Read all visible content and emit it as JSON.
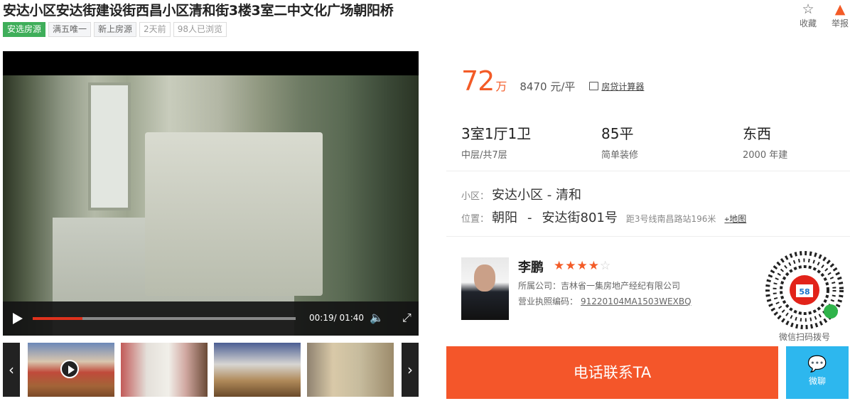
{
  "title": "安达小区安达街建设街西昌小区清和街3楼3室二中文化广场朝阳桥",
  "tags": [
    "安选房源",
    "满五唯一",
    "新上房源",
    "2天前",
    "98人已浏览"
  ],
  "actions": {
    "favorite": "收藏",
    "report": "举报"
  },
  "video": {
    "current": "00:19/",
    "total": "01:40",
    "progress": 0.19
  },
  "price": {
    "amount": "72",
    "unit": "万",
    "per": "8470 元/平",
    "calc": "房贷计算器"
  },
  "specs": [
    {
      "value": "3室1厅1卫",
      "label": "中层/共7层"
    },
    {
      "value": "85平",
      "label": "简单装修"
    },
    {
      "value": "东西",
      "label": "2000 年建"
    }
  ],
  "community": {
    "label": "小区：",
    "value": "安达小区 - 清和"
  },
  "location": {
    "label": "位置：",
    "district": "朝阳",
    "sep": "-",
    "street": "安达街801号",
    "distance": "距3号线南昌路站196米",
    "map": "地图"
  },
  "agent": {
    "name": "李鹏",
    "rating": 4,
    "company_label": "所属公司：",
    "company": "吉林省一集房地产经纪有限公司",
    "license_label": "营业执照编码：",
    "license": "91220104MA1503WEXBQ"
  },
  "qr_label": "微信扫码拨号",
  "call_button": "电话联系TA",
  "wechat_button": "微聊",
  "colors": {
    "accent": "#f35b27",
    "call": "#f4562a",
    "wechat": "#2db7ee",
    "tag_green": "#3fae5a"
  }
}
